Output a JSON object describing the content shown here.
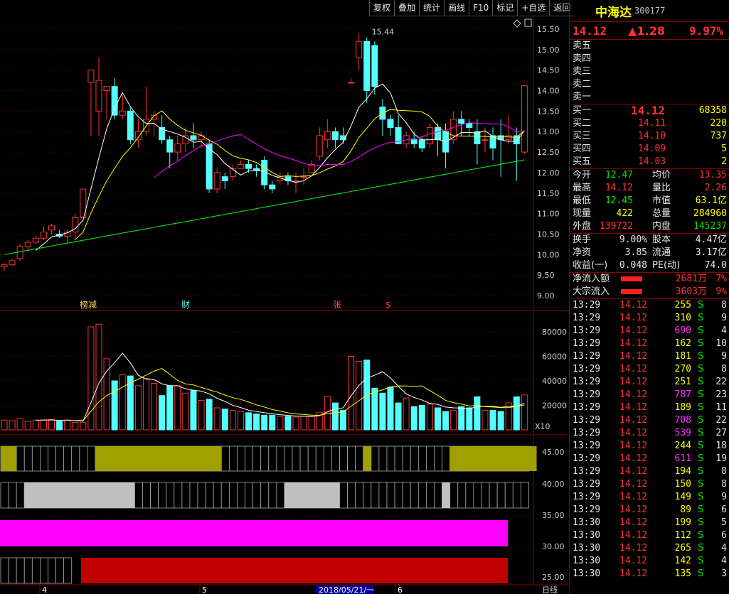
{
  "toolbar": [
    "复权",
    "叠加",
    "统计",
    "画线",
    "F10",
    "标记",
    "+自选",
    "返回"
  ],
  "stock": {
    "name": "中海达",
    "code": "300177",
    "price": "14.12",
    "change": "▲1.28",
    "pct": "9.97%"
  },
  "asks": [
    {
      "label": "卖五",
      "price": "",
      "vol": ""
    },
    {
      "label": "卖四",
      "price": "",
      "vol": ""
    },
    {
      "label": "卖三",
      "price": "",
      "vol": ""
    },
    {
      "label": "卖二",
      "price": "",
      "vol": ""
    },
    {
      "label": "卖一",
      "price": "",
      "vol": ""
    }
  ],
  "bids": [
    {
      "label": "买一",
      "price": "14.12",
      "vol": "68358"
    },
    {
      "label": "买二",
      "price": "14.11",
      "vol": "220"
    },
    {
      "label": "买三",
      "price": "14.10",
      "vol": "737"
    },
    {
      "label": "买四",
      "price": "14.09",
      "vol": "5"
    },
    {
      "label": "买五",
      "price": "14.03",
      "vol": "2"
    }
  ],
  "stats": [
    {
      "l1": "今开",
      "v1": "12.47",
      "l2": "均价",
      "v2": "13.35"
    },
    {
      "l1": "最高",
      "v1": "14.12",
      "l2": "量比",
      "v2": "2.26"
    },
    {
      "l1": "最低",
      "v1": "12.45",
      "l2": "市值",
      "v2": "63.1亿"
    },
    {
      "l1": "现量",
      "v1": "422",
      "l2": "总量",
      "v2": "284960"
    },
    {
      "l1": "外盘",
      "v1": "139722",
      "l2": "内盘",
      "v2": "145237"
    }
  ],
  "stats2": [
    {
      "l1": "换手",
      "v1": "9.00%",
      "l2": "股本",
      "v2": "4.47亿"
    },
    {
      "l1": "净资",
      "v1": "3.85",
      "l2": "流通",
      "v2": "3.17亿"
    },
    {
      "l1": "收益(一)",
      "v1": "0.048",
      "l2": "PE(动)",
      "v2": "74.0"
    }
  ],
  "flows": [
    {
      "label": "净流入额",
      "value": "2681万",
      "pct": "7%"
    },
    {
      "label": "大宗流入",
      "value": "3603万",
      "pct": "9%"
    }
  ],
  "ticks": [
    {
      "t": "13:29",
      "p": "14.12",
      "v": "255",
      "n": "8"
    },
    {
      "t": "13:29",
      "p": "14.12",
      "v": "310",
      "n": "9"
    },
    {
      "t": "13:29",
      "p": "14.12",
      "v": "690",
      "n": "4"
    },
    {
      "t": "13:29",
      "p": "14.12",
      "v": "162",
      "n": "10"
    },
    {
      "t": "13:29",
      "p": "14.12",
      "v": "181",
      "v2": "",
      "n": "9"
    },
    {
      "t": "13:29",
      "p": "14.12",
      "v": "270",
      "n": "8"
    },
    {
      "t": "13:29",
      "p": "14.12",
      "v": "251",
      "n": "22"
    },
    {
      "t": "13:29",
      "p": "14.12",
      "v": "787",
      "n": "23"
    },
    {
      "t": "13:29",
      "p": "14.12",
      "v": "189",
      "n": "11"
    },
    {
      "t": "13:29",
      "p": "14.12",
      "v": "708",
      "n": "22"
    },
    {
      "t": "13:29",
      "p": "14.12",
      "v": "539",
      "n": "27"
    },
    {
      "t": "13:29",
      "p": "14.12",
      "v": "244",
      "n": "18"
    },
    {
      "t": "13:29",
      "p": "14.12",
      "v": "611",
      "n": "19"
    },
    {
      "t": "13:29",
      "p": "14.12",
      "v": "194",
      "n": "8"
    },
    {
      "t": "13:29",
      "p": "14.12",
      "v": "150",
      "n": "8"
    },
    {
      "t": "13:29",
      "p": "14.12",
      "v": "149",
      "n": "9"
    },
    {
      "t": "13:29",
      "p": "14.12",
      "v": "89",
      "n": "6"
    },
    {
      "t": "13:30",
      "p": "14.12",
      "v": "199",
      "n": "5"
    },
    {
      "t": "13:30",
      "p": "14.12",
      "v": "112",
      "n": "6"
    },
    {
      "t": "13:30",
      "p": "14.12",
      "v": "265",
      "n": "4"
    },
    {
      "t": "13:30",
      "p": "14.12",
      "v": "142",
      "n": "4"
    },
    {
      "t": "13:30",
      "p": "14.12",
      "v": "135",
      "n": "3"
    }
  ],
  "tick_sell_flag": "S",
  "chart_data": {
    "type": "candlestick",
    "price_ticks": [
      "15.50",
      "15.00",
      "14.50",
      "14.00",
      "13.50",
      "13.00",
      "12.50",
      "12.00",
      "11.50",
      "11.00",
      "10.50",
      "10.00",
      "9.50",
      "9.00"
    ],
    "vol_ticks": [
      "80000",
      "60000",
      "40000",
      "20000"
    ],
    "vol_unit": "X10",
    "ind_ticks": [
      "45.00",
      "40.00",
      "35.00",
      "30.00",
      "25.00"
    ],
    "peak_label": "15.44",
    "markers": [
      "榜减",
      "财",
      "张",
      "$"
    ],
    "date_labels": [
      "4",
      "5",
      "2018/05/21/一",
      "6"
    ],
    "period": "日线",
    "candles": [
      [
        9.7,
        9.75,
        9.6,
        9.8
      ],
      [
        9.75,
        9.85,
        9.72,
        9.9
      ],
      [
        9.9,
        10.2,
        9.85,
        10.25
      ],
      [
        10.2,
        10.3,
        10.1,
        10.35
      ],
      [
        10.3,
        10.4,
        10.25,
        10.45
      ],
      [
        10.4,
        10.55,
        10.35,
        10.7
      ],
      [
        10.6,
        10.7,
        10.5,
        10.75
      ],
      [
        10.5,
        10.45,
        10.4,
        10.6
      ],
      [
        10.45,
        10.55,
        10.3,
        10.6
      ],
      [
        10.55,
        10.9,
        10.4,
        11.0
      ],
      [
        10.9,
        11.6,
        10.9,
        11.6
      ],
      [
        14.2,
        14.5,
        12.9,
        14.5
      ],
      [
        13.5,
        14.25,
        12.9,
        14.8
      ],
      [
        14.0,
        14.1,
        13.3,
        14.1
      ],
      [
        14.1,
        13.4,
        13.3,
        14.3
      ],
      [
        13.4,
        13.5,
        13.3,
        13.9
      ],
      [
        13.5,
        12.8,
        12.7,
        13.6
      ],
      [
        12.8,
        13.0,
        12.6,
        13.3
      ],
      [
        13.0,
        13.3,
        12.9,
        14.1
      ],
      [
        13.3,
        13.4,
        12.9,
        13.5
      ],
      [
        13.1,
        12.8,
        12.7,
        13.4
      ],
      [
        12.8,
        12.5,
        12.1,
        12.9
      ],
      [
        12.5,
        12.7,
        12.3,
        12.9
      ],
      [
        12.7,
        12.9,
        12.5,
        13.1
      ],
      [
        12.9,
        12.8,
        12.6,
        13.2
      ],
      [
        12.8,
        12.9,
        12.6,
        13.0
      ],
      [
        12.7,
        11.6,
        11.5,
        12.8
      ],
      [
        11.6,
        12.0,
        11.5,
        12.1
      ],
      [
        11.9,
        11.8,
        11.6,
        12.0
      ],
      [
        11.9,
        12.1,
        11.8,
        12.2
      ],
      [
        12.1,
        12.2,
        12.1,
        12.3
      ],
      [
        12.2,
        12.1,
        12.0,
        12.3
      ],
      [
        12.1,
        12.05,
        11.9,
        12.2
      ],
      [
        12.3,
        11.7,
        11.6,
        12.4
      ],
      [
        11.7,
        11.6,
        11.5,
        11.8
      ],
      [
        11.8,
        11.9,
        11.7,
        12.0
      ],
      [
        11.9,
        11.8,
        11.7,
        12.0
      ],
      [
        11.8,
        11.8,
        11.5,
        12.0
      ],
      [
        11.9,
        11.9,
        11.7,
        12.1
      ],
      [
        12.0,
        12.2,
        12.0,
        12.3
      ],
      [
        12.4,
        12.9,
        12.3,
        13.1
      ],
      [
        12.8,
        13.0,
        12.6,
        13.3
      ],
      [
        13.0,
        12.8,
        12.6,
        13.1
      ],
      [
        12.9,
        12.8,
        12.7,
        13.1
      ],
      [
        14.2,
        14.2,
        14.2,
        14.3
      ],
      [
        14.8,
        15.2,
        14.5,
        15.4
      ],
      [
        15.2,
        14.0,
        13.7,
        15.3
      ],
      [
        15.1,
        14.1,
        13.9,
        15.2
      ],
      [
        13.6,
        13.3,
        12.9,
        13.8
      ],
      [
        13.3,
        13.1,
        12.9,
        13.4
      ],
      [
        13.1,
        12.7,
        12.7,
        13.4
      ],
      [
        12.7,
        12.9,
        12.6,
        13.0
      ],
      [
        12.8,
        12.7,
        12.6,
        13.0
      ],
      [
        12.8,
        12.6,
        12.5,
        12.9
      ],
      [
        12.7,
        13.1,
        12.6,
        13.2
      ],
      [
        13.1,
        12.8,
        12.4,
        13.2
      ],
      [
        13.0,
        12.5,
        12.1,
        13.2
      ],
      [
        12.8,
        13.3,
        12.7,
        13.5
      ],
      [
        13.3,
        13.2,
        12.9,
        13.5
      ],
      [
        13.2,
        13.1,
        12.9,
        13.3
      ],
      [
        13.0,
        12.7,
        12.2,
        13.3
      ],
      [
        12.8,
        12.8,
        12.5,
        13.1
      ],
      [
        12.9,
        12.6,
        12.3,
        13.1
      ],
      [
        12.9,
        12.8,
        11.9,
        13.3
      ],
      [
        12.8,
        12.9,
        12.7,
        13.4
      ],
      [
        12.9,
        12.7,
        11.8,
        13.1
      ],
      [
        12.5,
        14.12,
        12.45,
        14.12
      ]
    ],
    "volume": [
      8000,
      7500,
      9000,
      7000,
      8000,
      8200,
      8500,
      7000,
      8000,
      6000,
      6000,
      84000,
      86000,
      58000,
      40000,
      45000,
      44000,
      36000,
      42000,
      38000,
      28000,
      36000,
      36000,
      30000,
      32000,
      24000,
      25000,
      18000,
      17000,
      16000,
      15000,
      14000,
      13000,
      12000,
      12000,
      11000,
      11000,
      10500,
      11000,
      11000,
      14000,
      27000,
      22000,
      16000,
      60000,
      56000,
      57000,
      34000,
      30000,
      35000,
      22000,
      26000,
      19000,
      20000,
      21000,
      18000,
      15000,
      16000,
      19000,
      18000,
      27000,
      16000,
      16000,
      15000,
      22000,
      27000,
      28500
    ],
    "ind1_yellow_segments": [
      [
        0,
        2
      ],
      [
        12,
        28
      ],
      [
        46,
        47
      ],
      [
        57,
        68
      ]
    ],
    "ind2_gray_segments": [
      [
        3,
        17
      ],
      [
        36,
        43
      ],
      [
        56,
        57
      ]
    ]
  }
}
